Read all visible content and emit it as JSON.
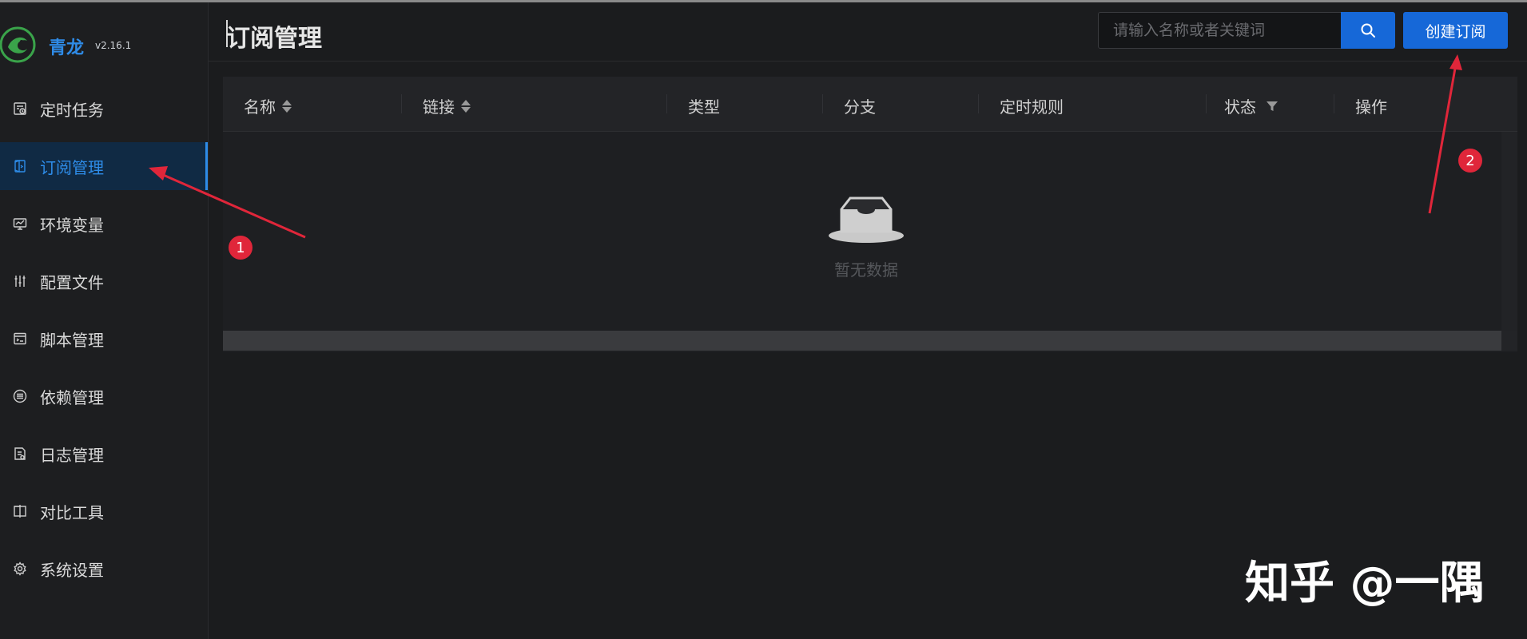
{
  "app": {
    "name": "青龙",
    "version": "v2.16.1"
  },
  "sidebar": {
    "items": [
      {
        "label": "定时任务",
        "icon": "scheduled-task-icon",
        "active": false
      },
      {
        "label": "订阅管理",
        "icon": "subscription-icon",
        "active": true
      },
      {
        "label": "环境变量",
        "icon": "monitor-icon",
        "active": false
      },
      {
        "label": "配置文件",
        "icon": "sliders-icon",
        "active": false
      },
      {
        "label": "脚本管理",
        "icon": "code-icon",
        "active": false
      },
      {
        "label": "依赖管理",
        "icon": "list-circle-icon",
        "active": false
      },
      {
        "label": "日志管理",
        "icon": "log-file-icon",
        "active": false
      },
      {
        "label": "对比工具",
        "icon": "diff-icon",
        "active": false
      },
      {
        "label": "系统设置",
        "icon": "gear-icon",
        "active": false
      }
    ]
  },
  "header": {
    "title": "订阅管理",
    "search_placeholder": "请输入名称或者关键词",
    "create_label": "创建订阅"
  },
  "table": {
    "columns": [
      "名称",
      "链接",
      "类型",
      "分支",
      "定时规则",
      "状态",
      "操作"
    ],
    "empty_text": "暂无数据"
  },
  "annotations": {
    "badge1": "1",
    "badge2": "2"
  },
  "watermark": "知乎 @一隅",
  "colors": {
    "accent": "#1668d8",
    "active_bg": "#102a44",
    "annotation": "#e0263a",
    "logo": "#2f8be6"
  }
}
